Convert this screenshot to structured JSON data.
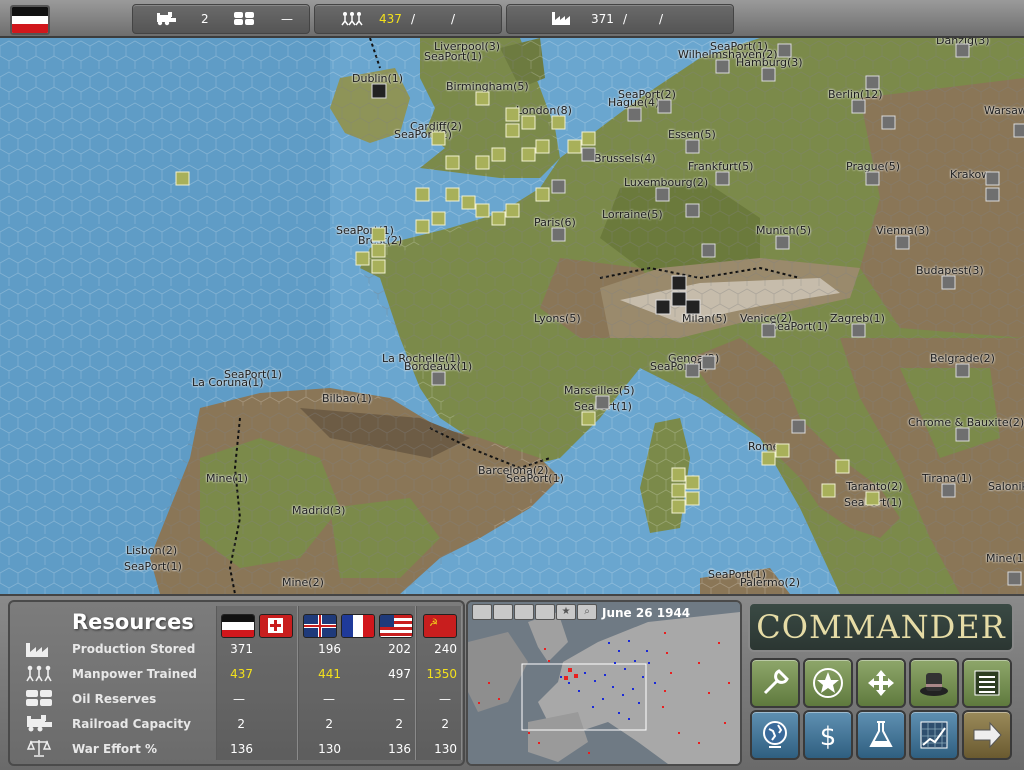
{
  "topbar": {
    "nation_flag": "germany-flag",
    "railroad": {
      "icon": "locomotive-icon",
      "value": "2"
    },
    "oil": {
      "icon": "oil-barrels-icon",
      "value": "—"
    },
    "manpower": {
      "icon": "manpower-icon",
      "value": "437",
      "sep1": "/",
      "sep2": "/"
    },
    "production": {
      "icon": "factory-icon",
      "value": "371",
      "sep1": "/",
      "sep2": "/"
    }
  },
  "map": {
    "labels": [
      "Dublin(1)",
      "Liverpool(3)",
      "SeaPort(1)",
      "Birmingham(5)",
      "London(8)",
      "Cardiff(2)",
      "SeaPort(2)",
      "Wilhelmshaven(2)",
      "SeaPort(1)",
      "Hamburg(3)",
      "Danzig(3)",
      "Berlin(12)",
      "Warsaw",
      "Hague(4)",
      "SeaPort(2)",
      "Essen(5)",
      "Brussels(4)",
      "Frankfurt(5)",
      "Luxembourg(2)",
      "Prague(5)",
      "Krakow",
      "Paris(6)",
      "Lorraine(5)",
      "SeaPort(1)",
      "Brest(2)",
      "Munich(5)",
      "Vienna(3)",
      "Budapest(3)",
      "Lyons(5)",
      "Milan(5)",
      "Venice(2)",
      "SeaPort(1)",
      "Zagreb(1)",
      "La Rochelle(1)",
      "Bordeaux(1)",
      "La Coruna(1)",
      "SeaPort(1)",
      "Bilbao(1)",
      "Genoa(2)",
      "SeaPort(1)",
      "Belgrade(2)",
      "Marseilles(5)",
      "SeaPort(1)",
      "Rome",
      "Chrome & Bauxite(2)",
      "Mine(1)",
      "Barcelona(2)",
      "SeaPort(1)",
      "Madrid(3)",
      "Taranto(2)",
      "SeaPort(1)",
      "Tirana(1)",
      "Salonika",
      "Lisbon(2)",
      "SeaPort(1)",
      "Mine(2)",
      "SeaPort(1)",
      "Palermo(2)",
      "Mine(1)"
    ]
  },
  "resources": {
    "title": "Resources",
    "rows": [
      {
        "icon": "factory-icon",
        "label": "Production Stored"
      },
      {
        "icon": "manpower-icon",
        "label": "Manpower Trained"
      },
      {
        "icon": "oil-barrels-icon",
        "label": "Oil Reserves"
      },
      {
        "icon": "locomotive-icon",
        "label": "Railroad Capacity"
      },
      {
        "icon": "scales-icon",
        "label": "War Effort %"
      }
    ],
    "columns": [
      {
        "flags": [
          "germany-flag",
          "italy-flag"
        ],
        "values": [
          "371",
          "437",
          "—",
          "2",
          "136"
        ]
      },
      {
        "flags": [
          "uk-flag",
          "france-flag",
          "usa-flag"
        ],
        "values_uk": [
          "196",
          "441",
          "—",
          "2",
          "130"
        ],
        "values_usa": [
          "202",
          "497",
          "—",
          "2",
          "136"
        ]
      },
      {
        "flags": [
          "ussr-flag"
        ],
        "values": [
          "240",
          "1350",
          "—",
          "2",
          "130"
        ]
      }
    ]
  },
  "minimap": {
    "date": "June 26 1944",
    "filters": [
      "filter-land-icon",
      "filter-air-icon",
      "filter-hq-icon",
      "filter-naval-icon",
      "filter-star-icon",
      "search-icon"
    ]
  },
  "commander": {
    "title": "COMMANDER",
    "buttons": [
      "wrench-icon",
      "star-icon",
      "move-arrows-icon",
      "diplomacy-hat-icon",
      "list-icon",
      "globe-icon",
      "dollar-icon",
      "flask-icon",
      "chart-icon",
      "next-turn-arrow-icon"
    ]
  },
  "colors": {
    "axis_unit": "#6f6f6f",
    "allied_unit": "#a8b05a",
    "sea": "#6aa6cf",
    "land_green": "#7b8a4a",
    "land_brown": "#8a7657",
    "ui_grey": "#7a7a7a",
    "highlight_yellow": "#f2e01c"
  }
}
